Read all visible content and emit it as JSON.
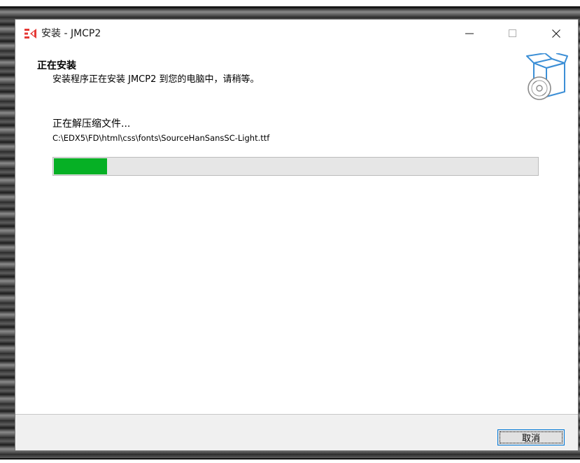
{
  "window": {
    "title": "安装 - JMCP2",
    "controls": {
      "minimize": "minimize-icon",
      "maximize": "maximize-icon",
      "close": "close-icon"
    }
  },
  "header": {
    "title": "正在安装",
    "subtitle": "安装程序正在安装 JMCP2 到您的电脑中，请稍等。",
    "icon": "install-box-icon"
  },
  "progress": {
    "status": "正在解压缩文件...",
    "current_file": "C:\\EDX5\\FD\\html\\css\\fonts\\SourceHanSansSC-Light.ttf",
    "fraction": 0.11,
    "color": "#06b025"
  },
  "footer": {
    "cancel_label": "取消"
  },
  "colors": {
    "accent": "#0078d7",
    "logo": "#e53935"
  }
}
